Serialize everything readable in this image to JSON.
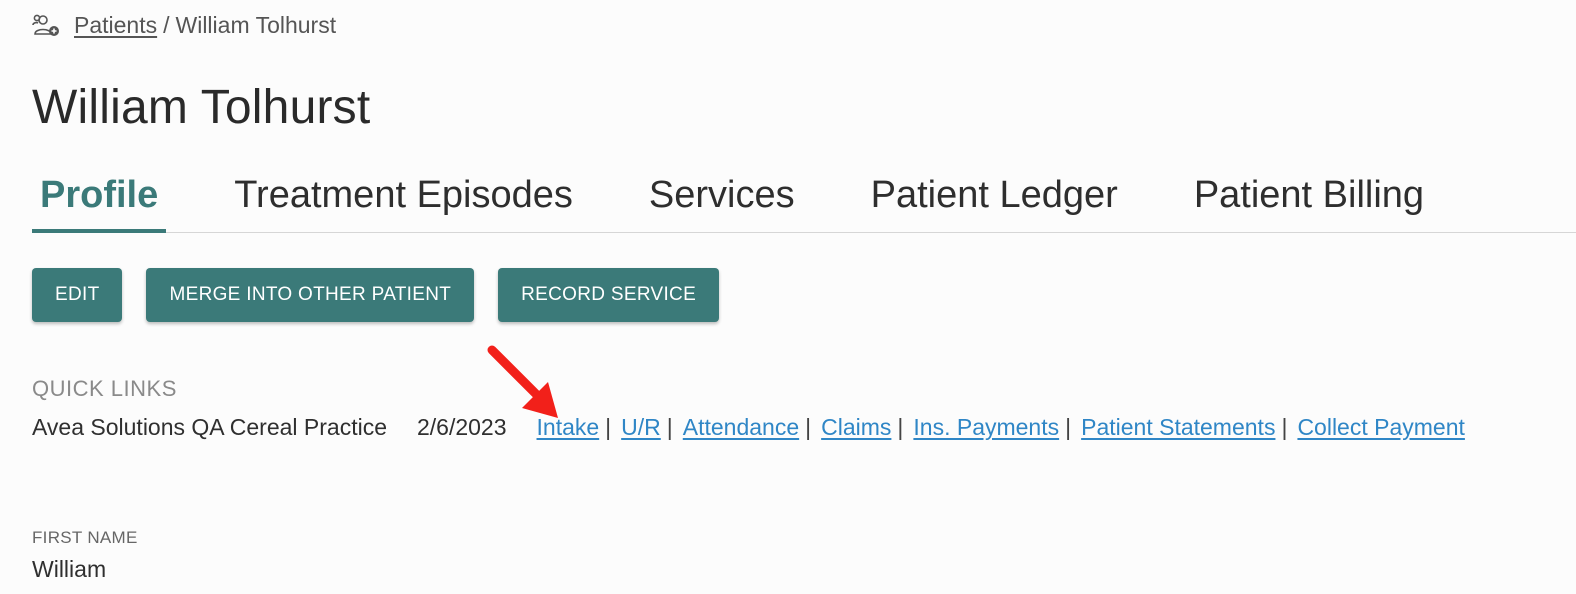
{
  "breadcrumb": {
    "icon": "patients-group-icon",
    "parent_label": "Patients",
    "separator": "/",
    "current_label": "William Tolhurst"
  },
  "page_title": "William Tolhurst",
  "tabs": [
    {
      "label": "Profile",
      "active": true
    },
    {
      "label": "Treatment Episodes",
      "active": false
    },
    {
      "label": "Services",
      "active": false
    },
    {
      "label": "Patient Ledger",
      "active": false
    },
    {
      "label": "Patient Billing",
      "active": false
    }
  ],
  "actions": {
    "edit_label": "EDIT",
    "merge_label": "MERGE INTO OTHER PATIENT",
    "record_service_label": "RECORD SERVICE"
  },
  "quick_links": {
    "heading": "QUICK LINKS",
    "practice": "Avea Solutions QA Cereal Practice",
    "date": "2/6/2023",
    "separator": "|",
    "links": [
      "Intake",
      "U/R",
      "Attendance",
      "Claims",
      "Ins. Payments",
      "Patient Statements",
      "Collect Payment"
    ]
  },
  "fields": {
    "first_name_label": "FIRST NAME",
    "first_name_value": "William"
  },
  "annotation": {
    "icon": "red-arrow-icon",
    "color": "#f2201a"
  },
  "colors": {
    "accent": "#3b7a79",
    "link": "#2f86c6"
  }
}
